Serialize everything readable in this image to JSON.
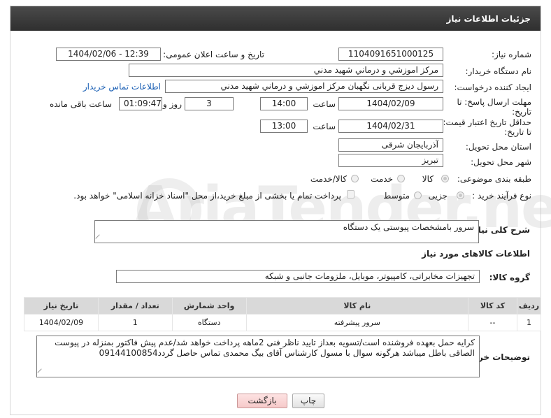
{
  "header": {
    "title": "جزئیات اطلاعات نیاز"
  },
  "fields": {
    "need_number_label": "شماره نیاز:",
    "need_number": "1104091651000125",
    "announce_label": "تاریخ و ساعت اعلان عمومی:",
    "announce_value": "1404/02/06 - 12:39",
    "buyer_org_label": "نام دستگاه خریدار:",
    "buyer_org": "مرکز اموزشي و درماني شهيد مدني",
    "requester_label": "ایجاد کننده درخواست:",
    "requester": "رسول دیزج قربانی نگهبان مرکز اموزشي و درماني شهيد مدني",
    "buyer_contact_link": "اطلاعات تماس خریدار",
    "deadline_label_1": "مهلت ارسال پاسخ: تا",
    "deadline_label_2": "تاریخ:",
    "deadline_date": "1404/02/09",
    "time_label": "ساعت",
    "deadline_time": "14:00",
    "days_value": "3",
    "days_label": "روز و",
    "remaining_time": "01:09:47",
    "remaining_label": "ساعت باقی مانده",
    "price_validity_label_1": "حداقل تاریخ اعتبار قیمت:",
    "price_validity_label_2": "تا تاریخ:",
    "price_validity_date": "1404/02/31",
    "price_validity_time": "13:00",
    "province_label": "استان محل تحویل:",
    "province": "آذربایجان شرقی",
    "city_label": "شهر محل تحویل:",
    "city": "تبریز",
    "category_label": "طبقه بندی موضوعی:",
    "category_options": [
      "کالا",
      "خدمت",
      "کالا/خدمت"
    ],
    "process_label": "نوع فرآیند خرید :",
    "process_options": [
      "جزیی",
      "متوسط"
    ],
    "payment_note": "پرداخت تمام یا بخشی از مبلغ خرید،از محل \"اسناد خزانه اسلامی\" خواهد بود."
  },
  "description": {
    "label": "شرح کلی نیاز:",
    "value": "سرور بامشخصات پیوستی یک دستگاه"
  },
  "goods_section": {
    "title": "اطلاعات کالاهای مورد نیاز",
    "group_label": "گروه کالا:",
    "group_value": "تجهیزات مخابراتی، کامپیوتر، موبایل، ملزومات جانبی و شبکه"
  },
  "table": {
    "headers": [
      "ردیف",
      "کد کالا",
      "نام کالا",
      "واحد شمارش",
      "تعداد / مقدار",
      "تاریخ نیاز"
    ],
    "rows": [
      [
        "1",
        "--",
        "سرور پیشرفته",
        "دستگاه",
        "1",
        "1404/02/09"
      ]
    ]
  },
  "buyer_notes": {
    "label": "توضیحات خریدار:",
    "value": "کرایه حمل بعهده فروشنده است/تسویه بعداز تایید ناظر فنی 2ماهه پرداخت خواهد شد/عدم پیش فاکتور بمنزله در پیوست الصاقی باطل میباشد هرگونه سوال با مسول کارشناس آقای بیگ محمدی تماس حاصل گردد09144100854"
  },
  "buttons": {
    "print": "چاپ",
    "back": "بازگشت"
  },
  "watermark": "AriaTender.net"
}
